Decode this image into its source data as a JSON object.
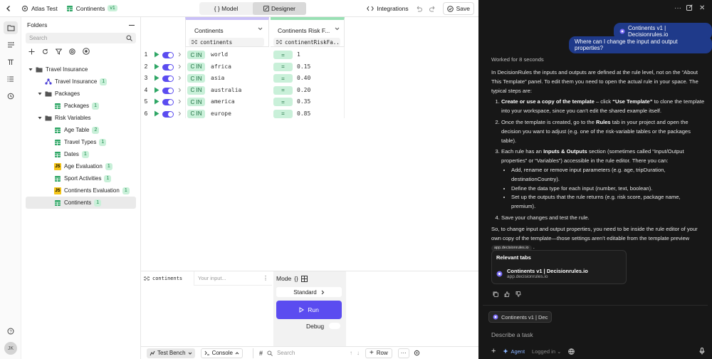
{
  "topbar": {
    "project": "Atlas Test",
    "doc": "Continents",
    "version": "v1",
    "model_tab": "{ } Model",
    "designer_tab": "Designer",
    "integrations": "Integrations",
    "save": "Save"
  },
  "folders": {
    "title": "Folders",
    "search_placeholder": "Search",
    "tree": [
      {
        "label": "Travel Insurance",
        "type": "folder",
        "level": 0
      },
      {
        "label": "Travel Insurance",
        "type": "flow",
        "level": 1,
        "count": "1"
      },
      {
        "label": "Packages",
        "type": "folder",
        "level": 1
      },
      {
        "label": "Packages",
        "type": "table",
        "level": 2,
        "count": "1"
      },
      {
        "label": "Risk Variables",
        "type": "folder",
        "level": 1
      },
      {
        "label": "Age Table",
        "type": "table",
        "level": 2,
        "count": "2"
      },
      {
        "label": "Travel Types",
        "type": "table",
        "level": 2,
        "count": "1"
      },
      {
        "label": "Dates",
        "type": "table",
        "level": 2,
        "count": "1"
      },
      {
        "label": "Age Evaluation",
        "type": "js",
        "level": 2,
        "count": "1"
      },
      {
        "label": "Sport Activities",
        "type": "table",
        "level": 2,
        "count": "1"
      },
      {
        "label": "Continents Evaluation",
        "type": "js",
        "level": 2,
        "count": "1"
      },
      {
        "label": "Continents",
        "type": "table",
        "level": 2,
        "count": "1",
        "selected": true
      }
    ]
  },
  "table": {
    "input_header": "Continents",
    "input_sub": "continents",
    "output_header": "Continents Risk F...",
    "output_sub": "continentRiskFa...",
    "rows": [
      {
        "n": "1",
        "op": "C IN",
        "input": "world",
        "out_op": "=",
        "output": "1"
      },
      {
        "n": "2",
        "op": "C IN",
        "input": "africa",
        "out_op": "=",
        "output": "0.15"
      },
      {
        "n": "3",
        "op": "C IN",
        "input": "asia",
        "out_op": "=",
        "output": "0.40"
      },
      {
        "n": "4",
        "op": "C IN",
        "input": "australia",
        "out_op": "=",
        "output": "0.20"
      },
      {
        "n": "5",
        "op": "C IN",
        "input": "america",
        "out_op": "=",
        "output": "0.35"
      },
      {
        "n": "6",
        "op": "C IN",
        "input": "europe",
        "out_op": "=",
        "output": "0.85"
      }
    ]
  },
  "bench": {
    "field": "continents",
    "placeholder": "Your input...",
    "mode": "Mode",
    "mode_value": "Standard",
    "run": "Run",
    "debug": "Debug"
  },
  "statusbar": {
    "test_bench": "Test Bench",
    "console": "Console",
    "search": "Search",
    "row": "Row"
  },
  "chat": {
    "tab_bubble": "Continents v1 | Decisionrules.io",
    "question": "Where can I change the input and output properties?",
    "worked": "Worked for 8 seconds",
    "intro": "In DecisionRules the inputs and outputs are defined at the rule level, not on the “About This Template” panel. To edit them you need to open the actual rule in your space. The typical steps are:",
    "step1_b": "Create or use a copy of the template",
    "step1_mid": " – click ",
    "step1_b2": "“Use Template”",
    "step1_rest": " to clone the template into your workspace, since you can’t edit the shared example itself.",
    "step2_a": "Once the template is created, go to the ",
    "step2_b": "Rules",
    "step2_rest": " tab in your project and open the decision you want to adjust (e.g. one of the risk-variable tables or the packages table).",
    "step3_a": "Each rule has an ",
    "step3_b": "Inputs & Outputs",
    "step3_rest": " section (sometimes called “Input/Output properties” or “Variables”) accessible in the rule editor. There you can:",
    "bullets": [
      "Add, rename or remove input parameters (e.g. age, tripDuration, destinationCountry).",
      "Define the data type for each input (number, text, boolean).",
      "Set up the outputs that the rule returns (e.g. risk score, package name, premium)."
    ],
    "step4": "Save your changes and test the rule.",
    "outro": "So, to change input and output properties, you need to be inside the rule editor of your own copy of the template—those settings aren’t editable from the template preview",
    "source_chip": "app.decisionrules.io",
    "relevant_title": "Relevant tabs",
    "rel_item_title": "Continents v1 | Decisionrules.io",
    "rel_item_url": "app.decisionrules.io",
    "context_chip": "Continents v1 | Dec",
    "compose_placeholder": "Describe a task",
    "agent": "Agent",
    "logged_in": "Logged in"
  },
  "colors": {
    "accent": "#5b4cf0",
    "green_pill": "#c9f0d9",
    "chat_bg": "#171717",
    "bubble": "#1f3a8a"
  }
}
